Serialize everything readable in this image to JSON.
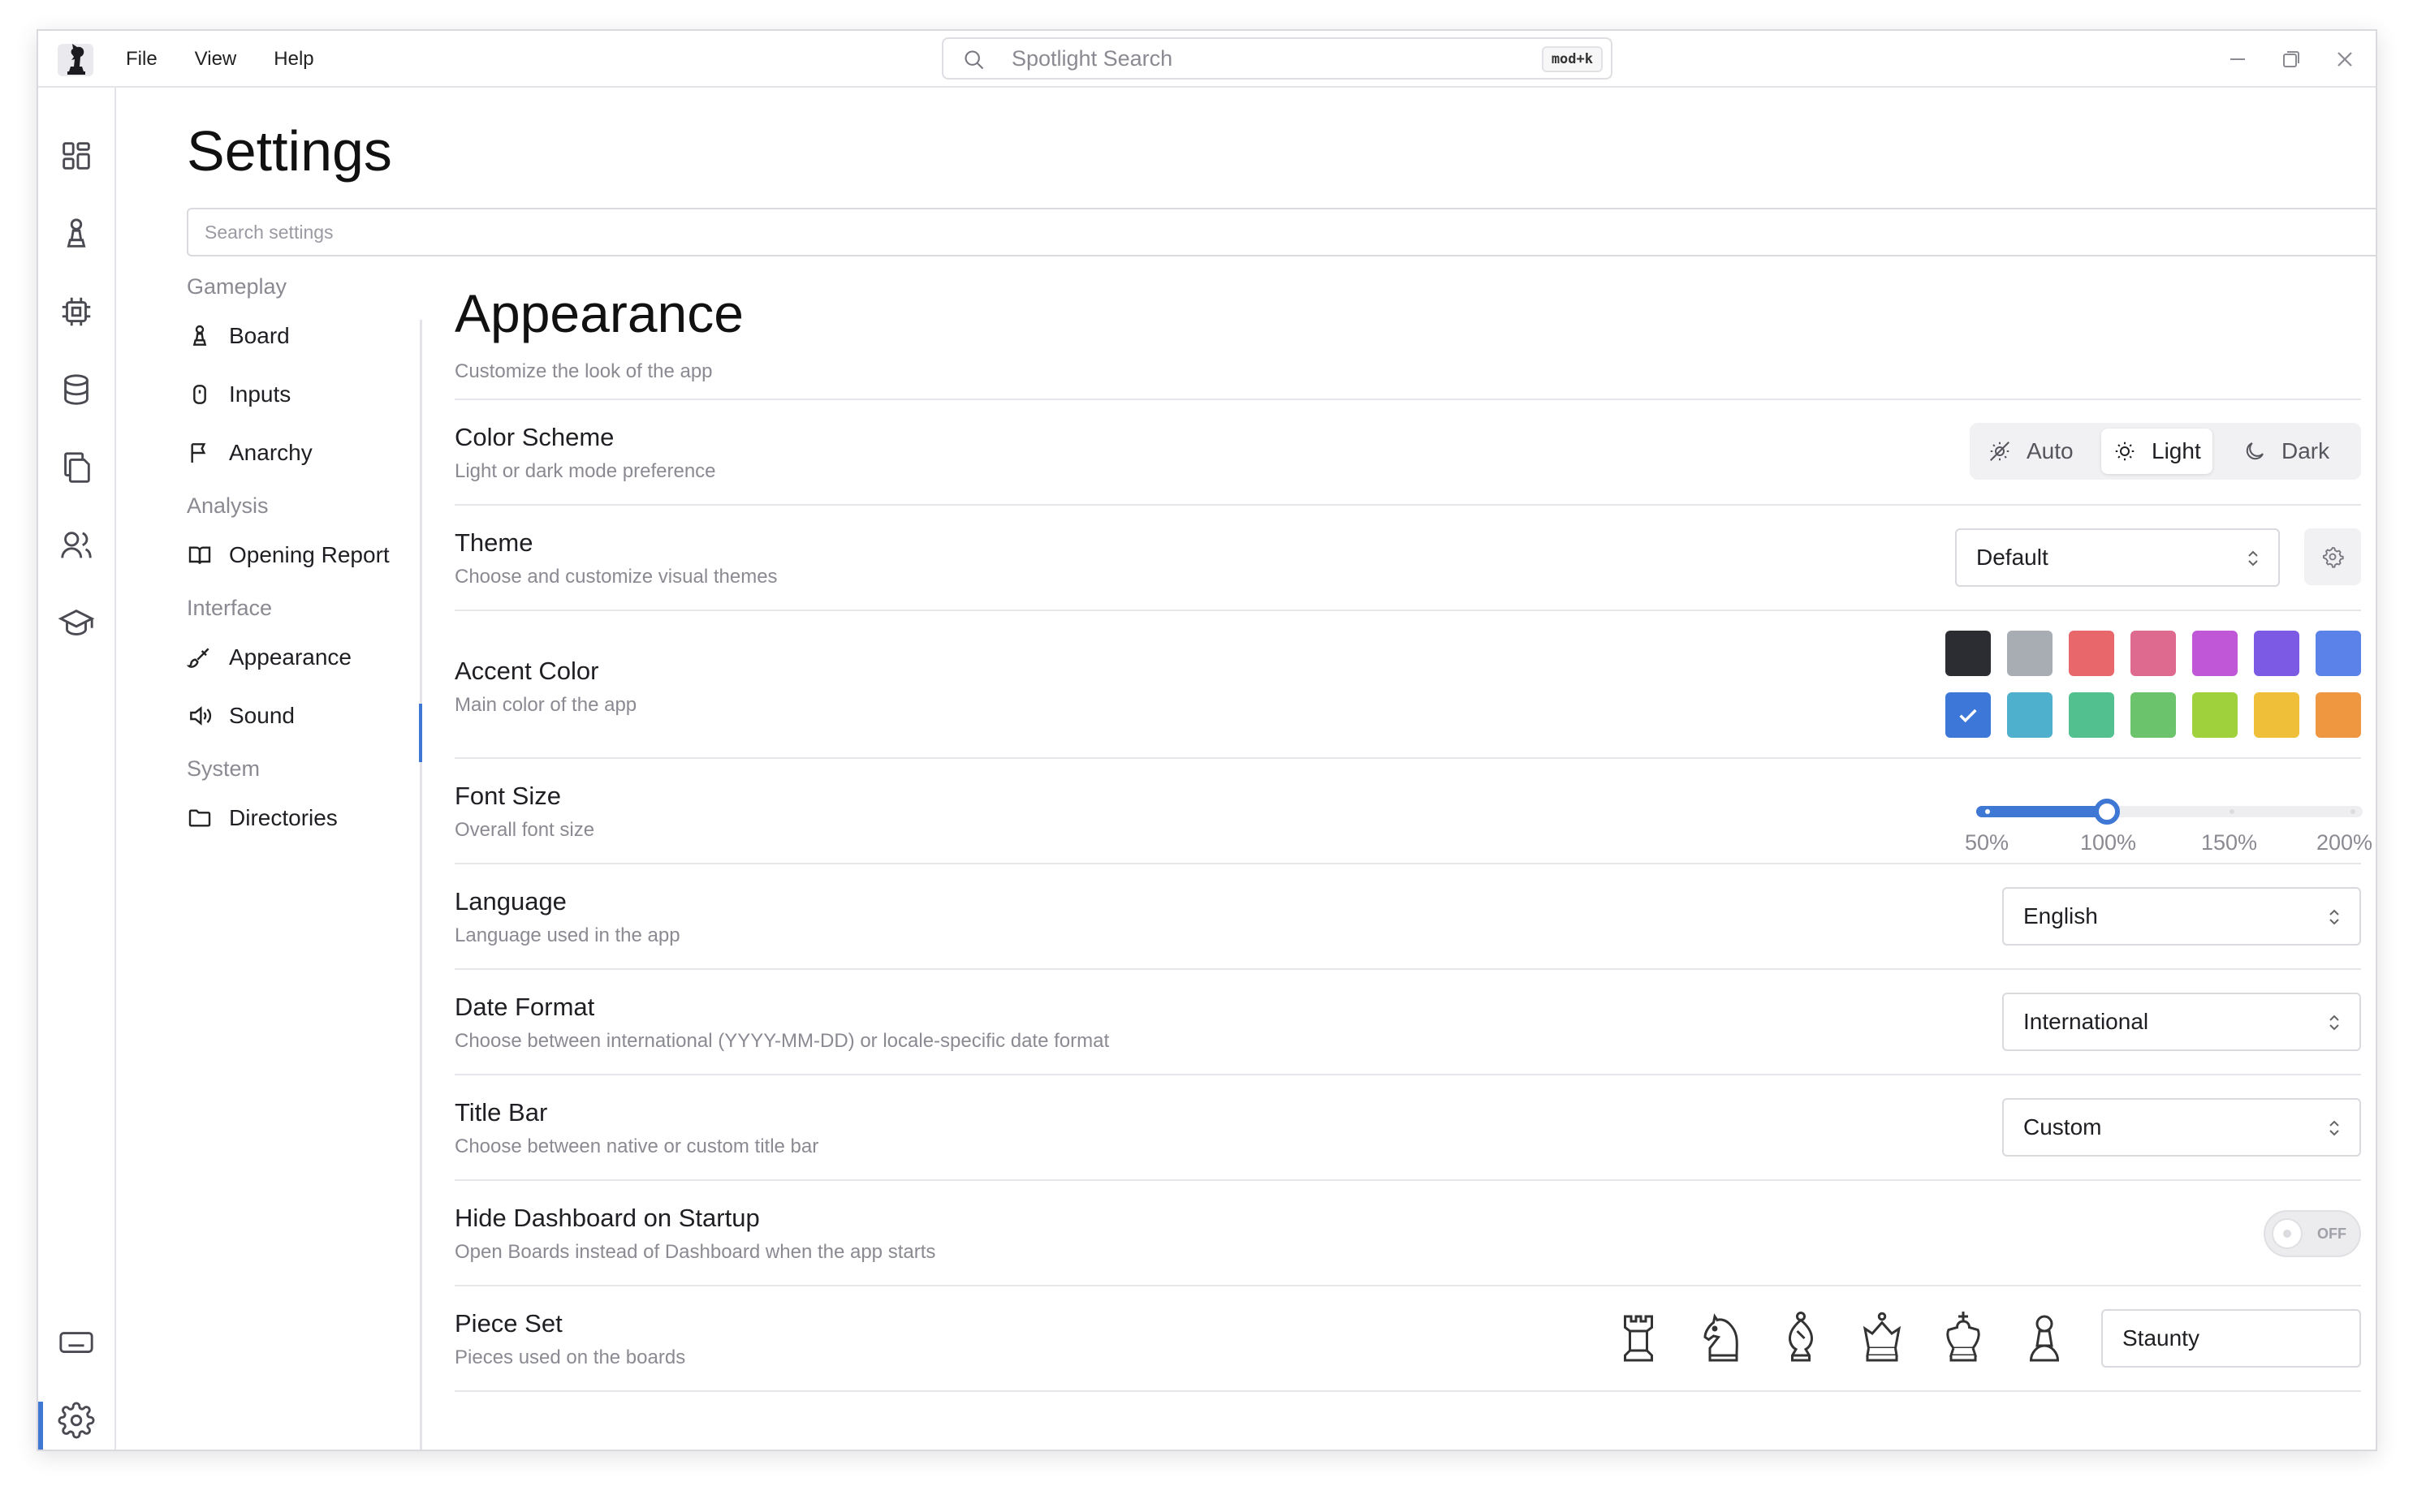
{
  "titlebar": {
    "menu": [
      "File",
      "View",
      "Help"
    ],
    "search_placeholder": "Spotlight Search",
    "shortcut": "mod+k"
  },
  "page": {
    "title": "Settings",
    "search_placeholder": "Search settings"
  },
  "nav": {
    "gameplay": "Gameplay",
    "board": "Board",
    "inputs": "Inputs",
    "anarchy": "Anarchy",
    "analysis": "Analysis",
    "opening_report": "Opening Report",
    "interface": "Interface",
    "appearance": "Appearance",
    "sound": "Sound",
    "system": "System",
    "directories": "Directories"
  },
  "section": {
    "title": "Appearance",
    "subtitle": "Customize the look of the app"
  },
  "settings": {
    "color_scheme": {
      "label": "Color Scheme",
      "desc": "Light or dark mode preference",
      "options": [
        "Auto",
        "Light",
        "Dark"
      ],
      "selected": "Light"
    },
    "theme": {
      "label": "Theme",
      "desc": "Choose and customize visual themes",
      "value": "Default"
    },
    "accent_color": {
      "label": "Accent Color",
      "desc": "Main color of the app",
      "swatches": [
        "#2b2d33",
        "#a8adb4",
        "#e8676a",
        "#df6a8f",
        "#c057d6",
        "#7d5ae3",
        "#5b82e8",
        "#3d78d8",
        "#4eb0cd",
        "#53c08f",
        "#6bc46b",
        "#9fd13d",
        "#f0bf39",
        "#ef9740"
      ],
      "selected": "#3d78d8"
    },
    "font_size": {
      "label": "Font Size",
      "desc": "Overall font size",
      "marks": [
        "50%",
        "100%",
        "150%",
        "200%"
      ],
      "value": "100%"
    },
    "language": {
      "label": "Language",
      "desc": "Language used in the app",
      "value": "English"
    },
    "date_format": {
      "label": "Date Format",
      "desc": "Choose between international (YYYY-MM-DD) or locale-specific date format",
      "value": "International"
    },
    "title_bar": {
      "label": "Title Bar",
      "desc": "Choose between native or custom title bar",
      "value": "Custom"
    },
    "hide_dashboard": {
      "label": "Hide Dashboard on Startup",
      "desc": "Open Boards instead of Dashboard when the app starts",
      "state": "OFF"
    },
    "piece_set": {
      "label": "Piece Set",
      "desc": "Pieces used on the boards",
      "value": "Staunty"
    }
  },
  "icons": {
    "rail": [
      "dashboard-icon",
      "pawn-icon",
      "cpu-chip-icon",
      "database-icon",
      "files-icon",
      "users-icon",
      "graduation-cap-icon",
      "keyboard-icon",
      "settings-gear-icon"
    ],
    "pieces": [
      "rook-icon",
      "knight-icon",
      "bishop-icon",
      "queen-icon",
      "king-icon",
      "pawn-icon"
    ]
  },
  "colors": {
    "accent": "#3f77d4"
  }
}
